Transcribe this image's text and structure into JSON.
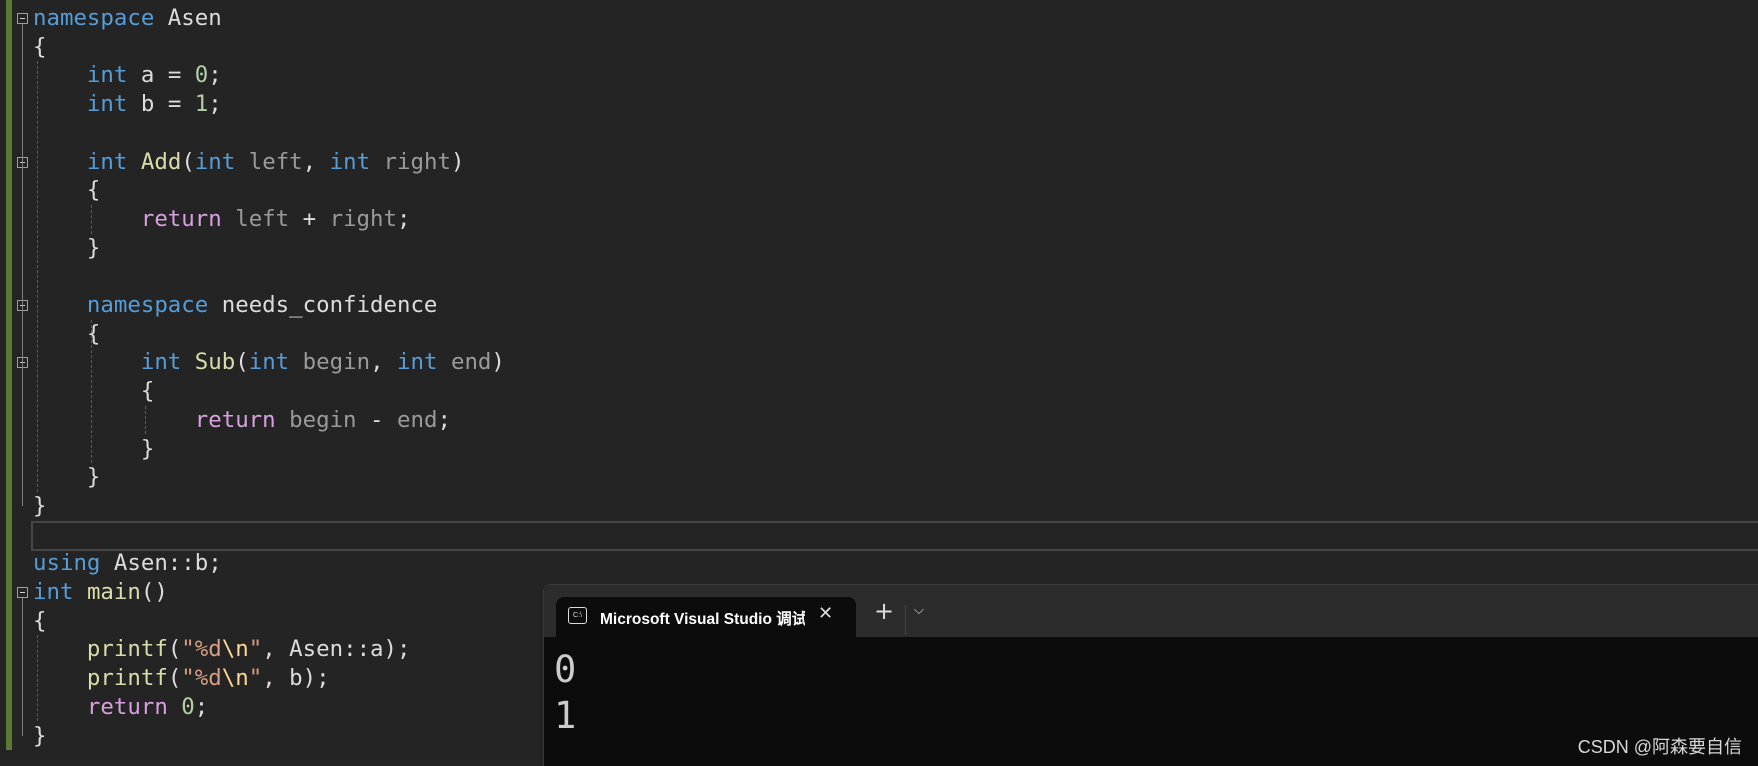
{
  "editor": {
    "lines": [
      {
        "fold": true,
        "tokens": [
          [
            "kw",
            "namespace"
          ],
          [
            "id",
            " Asen"
          ]
        ]
      },
      {
        "tokens": [
          [
            "id",
            "{"
          ]
        ]
      },
      {
        "tokens": [
          [
            "id",
            "    "
          ],
          [
            "kw",
            "int"
          ],
          [
            "id",
            " a = "
          ],
          [
            "num",
            "0"
          ],
          [
            "id",
            ";"
          ]
        ]
      },
      {
        "tokens": [
          [
            "id",
            "    "
          ],
          [
            "kw",
            "int"
          ],
          [
            "id",
            " b = "
          ],
          [
            "num",
            "1"
          ],
          [
            "id",
            ";"
          ]
        ]
      },
      {
        "tokens": []
      },
      {
        "fold": true,
        "tokens": [
          [
            "id",
            "    "
          ],
          [
            "kw",
            "int"
          ],
          [
            "id",
            " "
          ],
          [
            "fn",
            "Add"
          ],
          [
            "id",
            "("
          ],
          [
            "kw",
            "int"
          ],
          [
            "param",
            " left"
          ],
          [
            "id",
            ", "
          ],
          [
            "kw",
            "int"
          ],
          [
            "param",
            " right"
          ],
          [
            "id",
            ")"
          ]
        ]
      },
      {
        "tokens": [
          [
            "id",
            "    {"
          ]
        ]
      },
      {
        "tokens": [
          [
            "id",
            "        "
          ],
          [
            "ctl",
            "return"
          ],
          [
            "param",
            " left"
          ],
          [
            "id",
            " + "
          ],
          [
            "param",
            "right"
          ],
          [
            "id",
            ";"
          ]
        ]
      },
      {
        "tokens": [
          [
            "id",
            "    }"
          ]
        ]
      },
      {
        "tokens": []
      },
      {
        "fold": true,
        "tokens": [
          [
            "id",
            "    "
          ],
          [
            "kw",
            "namespace"
          ],
          [
            "id",
            " needs_confidence"
          ]
        ]
      },
      {
        "tokens": [
          [
            "id",
            "    {"
          ]
        ]
      },
      {
        "fold": true,
        "tokens": [
          [
            "id",
            "        "
          ],
          [
            "kw",
            "int"
          ],
          [
            "id",
            " "
          ],
          [
            "fn",
            "Sub"
          ],
          [
            "id",
            "("
          ],
          [
            "kw",
            "int"
          ],
          [
            "param",
            " begin"
          ],
          [
            "id",
            ", "
          ],
          [
            "kw",
            "int"
          ],
          [
            "param",
            " end"
          ],
          [
            "id",
            ")"
          ]
        ]
      },
      {
        "tokens": [
          [
            "id",
            "        {"
          ]
        ]
      },
      {
        "tokens": [
          [
            "id",
            "            "
          ],
          [
            "ctl",
            "return"
          ],
          [
            "param",
            " begin"
          ],
          [
            "id",
            " - "
          ],
          [
            "param",
            "end"
          ],
          [
            "id",
            ";"
          ]
        ]
      },
      {
        "tokens": [
          [
            "id",
            "        }"
          ]
        ]
      },
      {
        "tokens": [
          [
            "id",
            "    }"
          ]
        ]
      },
      {
        "tokens": [
          [
            "id",
            "}"
          ]
        ]
      },
      {
        "tokens": []
      },
      {
        "tokens": [
          [
            "kw",
            "using"
          ],
          [
            "id",
            " Asen::b;"
          ]
        ]
      },
      {
        "fold": true,
        "tokens": [
          [
            "kw",
            "int"
          ],
          [
            "id",
            " "
          ],
          [
            "fn",
            "main"
          ],
          [
            "id",
            "()"
          ]
        ]
      },
      {
        "tokens": [
          [
            "id",
            "{"
          ]
        ]
      },
      {
        "tokens": [
          [
            "id",
            "    "
          ],
          [
            "fn",
            "printf"
          ],
          [
            "id",
            "("
          ],
          [
            "str",
            "\"%d"
          ],
          [
            "esc",
            "\\n"
          ],
          [
            "str",
            "\""
          ],
          [
            "id",
            ", Asen::a);"
          ]
        ]
      },
      {
        "tokens": [
          [
            "id",
            "    "
          ],
          [
            "fn",
            "printf"
          ],
          [
            "id",
            "("
          ],
          [
            "str",
            "\"%d"
          ],
          [
            "esc",
            "\\n"
          ],
          [
            "str",
            "\""
          ],
          [
            "id",
            ", b);"
          ]
        ]
      },
      {
        "tokens": [
          [
            "id",
            "    "
          ],
          [
            "ctl",
            "return"
          ],
          [
            "id",
            " "
          ],
          [
            "num",
            "0"
          ],
          [
            "id",
            ";"
          ]
        ]
      },
      {
        "tokens": [
          [
            "id",
            "}"
          ]
        ]
      }
    ]
  },
  "terminal": {
    "tab_title": "Microsoft Visual Studio 调试控制台",
    "tab_icon": "console-icon",
    "new_tab": "+",
    "dropdown": "⌄",
    "close": "✕",
    "output": [
      "0",
      "1"
    ]
  },
  "watermark": "CSDN @阿森要自信",
  "colors": {
    "keyword": "#569cd6",
    "function": "#dcdcaa",
    "number": "#b5cea8",
    "control": "#d8a0df",
    "string": "#d69d85",
    "escape": "#ffd68f",
    "background": "#242424"
  }
}
